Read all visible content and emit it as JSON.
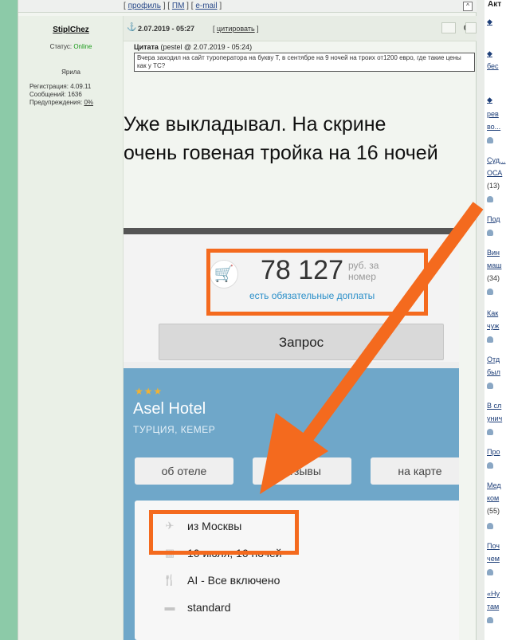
{
  "topbar": {
    "profile_link": "профиль",
    "pm_link": "ПМ",
    "email_link": "e-mail",
    "up_icon": "^"
  },
  "author": {
    "name": "StiplChez",
    "status_label": "Статус:",
    "status_value": "Online",
    "rank": "Ярила",
    "registration": "Регистрация: 4.09.11",
    "messages": "Сообщений: 1636",
    "warnings_label": "Предупреждения:",
    "warnings_value": "0%"
  },
  "post": {
    "date": "2.07.2019 - 05:27",
    "quote_button": "цитировать",
    "rating": "0",
    "quote_title_label": "Цитата",
    "quote_title_meta": "(pestel @ 2.07.2019 - 05:24)",
    "quote_text": "Вчера заходил на сайт туроператора на букву Т, в сентябре на 9 ночей на троих от1200 евро, где такие цены как у ТС?",
    "text": "Уже выкладывал. На скрине очень говеная тройка на 16 ночей"
  },
  "screenshot": {
    "price": "78 127",
    "price_unit": "руб. за номер",
    "extra_fees": "есть обязательные доплаты",
    "request_button": "Запрос",
    "stars": "★★★",
    "hotel_name": "Asel Hotel",
    "hotel_location": "ТУРЦИЯ, КЕМЕР",
    "tab_about": "об отеле",
    "tab_reviews": "отзывы",
    "tab_map": "на карте",
    "departure": "из Москвы",
    "dates": "10 июля, 16 ночей",
    "board": "AI - Все включено",
    "room": "standard",
    "accent": "#f46a1e"
  },
  "sidebar": {
    "heading": "Акт",
    "items": [
      "Суд...",
      "ОСА",
      "(13)",
      "Под",
      "Вин",
      "маш",
      "(34)",
      "Как",
      "чуж",
      "Отд",
      "был",
      "В сл",
      "унич",
      "Про",
      "Мед",
      "ком",
      "(55)",
      "Поч",
      "чем",
      "«Ну",
      "там"
    ],
    "top_items": [
      "бес",
      "рев",
      "во..."
    ]
  }
}
